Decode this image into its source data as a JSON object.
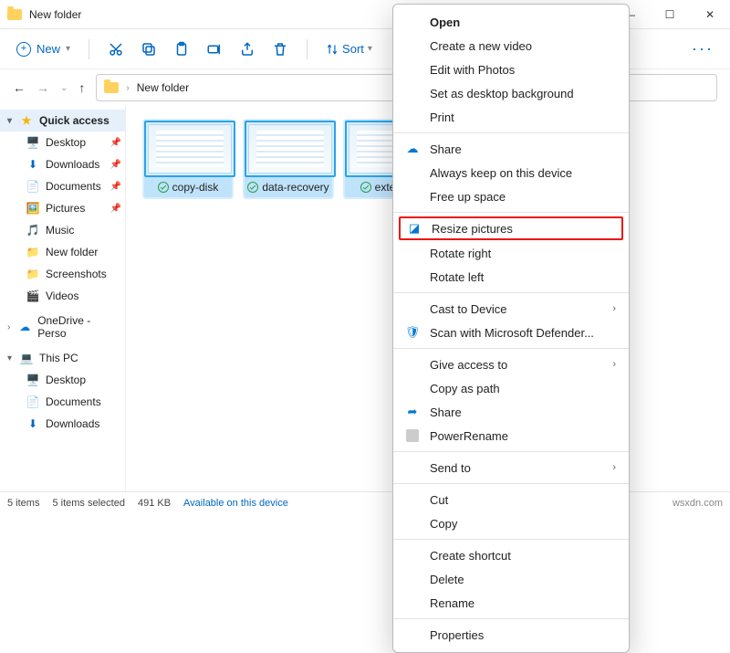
{
  "title": "New folder",
  "winbtns": {
    "min": "—",
    "max": "☐",
    "close": "✕"
  },
  "toolbar": {
    "new": "New",
    "sort": "Sort"
  },
  "breadcrumb": {
    "name": "New folder"
  },
  "sidebar": {
    "quick": "Quick access",
    "items": [
      {
        "label": "Desktop",
        "icon": "🖥️"
      },
      {
        "label": "Downloads",
        "icon": "⬇"
      },
      {
        "label": "Documents",
        "icon": "📄"
      },
      {
        "label": "Pictures",
        "icon": "🖼️"
      },
      {
        "label": "Music",
        "icon": "🎵"
      },
      {
        "label": "New folder",
        "icon": "📁"
      },
      {
        "label": "Screenshots",
        "icon": "📁"
      },
      {
        "label": "Videos",
        "icon": "🎬"
      }
    ],
    "onedrive": "OneDrive - Perso",
    "thispc": "This PC",
    "pc": [
      {
        "label": "Desktop",
        "icon": "🖥️"
      },
      {
        "label": "Documents",
        "icon": "📄"
      },
      {
        "label": "Downloads",
        "icon": "⬇"
      }
    ]
  },
  "files": [
    {
      "name": "copy-disk"
    },
    {
      "name": "data-recovery"
    },
    {
      "name": "extend-n"
    }
  ],
  "status": {
    "count": "5 items",
    "sel": "5 items selected",
    "size": "491 KB",
    "avail": "Available on this device",
    "watermark": "wsxdn.com"
  },
  "menu": {
    "open": "Open",
    "create_video": "Create a new video",
    "edit_photos": "Edit with Photos",
    "set_bg": "Set as desktop background",
    "print": "Print",
    "share": "Share",
    "always_keep": "Always keep on this device",
    "free_up": "Free up space",
    "resize": "Resize pictures",
    "rotate_r": "Rotate right",
    "rotate_l": "Rotate left",
    "cast": "Cast to Device",
    "scan": "Scan with Microsoft Defender...",
    "give_access": "Give access to",
    "copy_path": "Copy as path",
    "share2": "Share",
    "powerrename": "PowerRename",
    "send_to": "Send to",
    "cut": "Cut",
    "copy": "Copy",
    "shortcut": "Create shortcut",
    "delete": "Delete",
    "rename": "Rename",
    "properties": "Properties"
  }
}
